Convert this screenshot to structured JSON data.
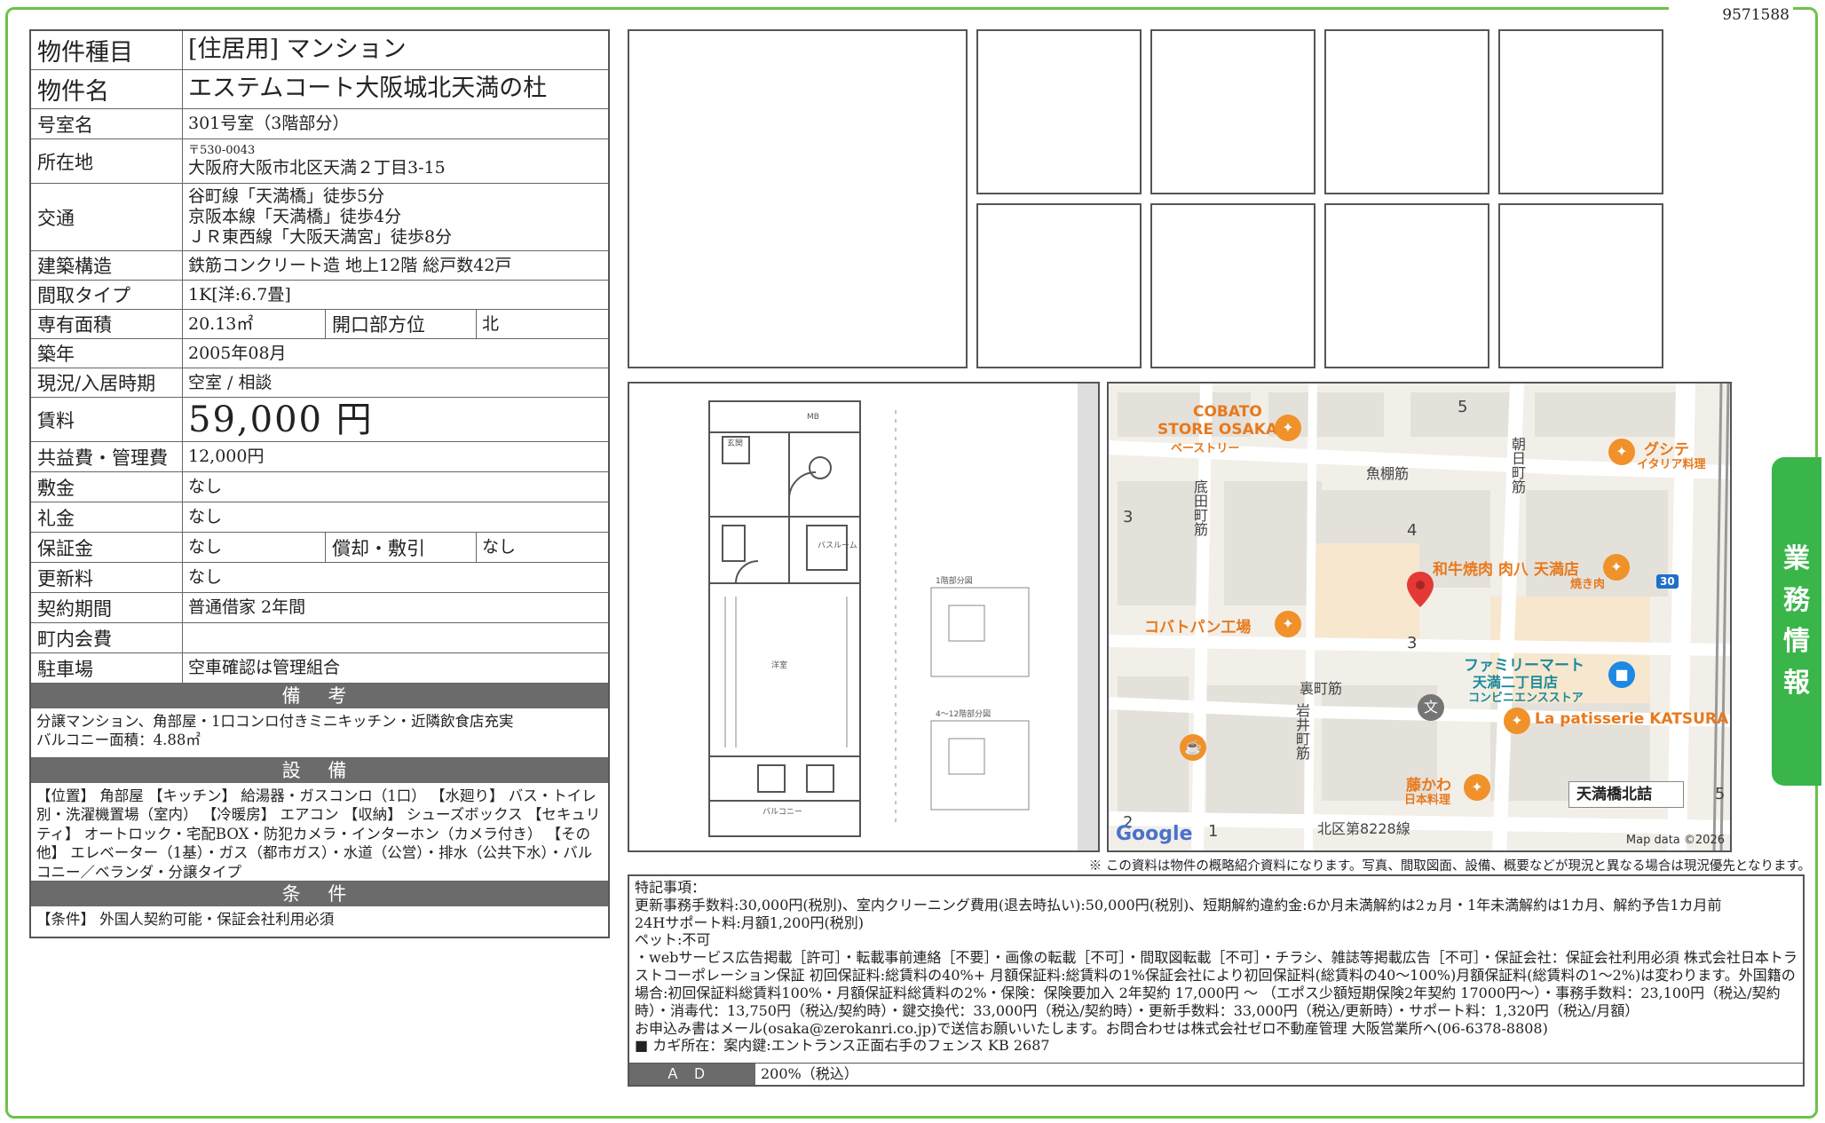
{
  "doc_id": "9571588",
  "property": {
    "type_label": "物件種目",
    "type_value": "[住居用] マンション",
    "name_label": "物件名",
    "name_value": "エステムコート大阪城北天満の杜",
    "room_label": "号室名",
    "room_value": "301号室（3階部分）",
    "address_label": "所在地",
    "postal": "〒530-0043",
    "address": "大阪府大阪市北区天満２丁目3-15",
    "transport_label": "交通",
    "transport": [
      "谷町線「天満橋」徒歩5分",
      "京阪本線「天満橋」徒歩4分",
      "ＪＲ東西線「大阪天満宮」徒歩8分"
    ],
    "structure_label": "建築構造",
    "structure_value": "鉄筋コンクリート造 地上12階 総戸数42戸",
    "layout_label": "間取タイプ",
    "layout_value": "1K[洋:6.7畳]",
    "area_label": "専有面積",
    "area_value": "20.13㎡",
    "direction_label": "開口部方位",
    "direction_value": "北",
    "built_label": "築年",
    "built_value": "2005年08月",
    "status_label": "現況/入居時期",
    "status_value": "空室 / 相談",
    "rent_label": "賃料",
    "rent_value": "59,000 円",
    "fee_label": "共益費・管理費",
    "fee_value": "12,000円",
    "deposit_label": "敷金",
    "deposit_value": "なし",
    "keymoney_label": "礼金",
    "keymoney_value": "なし",
    "guarantee_label": "保証金",
    "guarantee_value": "なし",
    "amort_label": "償却・敷引",
    "amort_value": "なし",
    "renewal_label": "更新料",
    "renewal_value": "なし",
    "contract_label": "契約期間",
    "contract_value": "普通借家 2年間",
    "town_label": "町内会費",
    "town_value": "",
    "parking_label": "駐車場",
    "parking_value": "空車確認は管理組合"
  },
  "remarks": {
    "title": "備 考",
    "lines": [
      "分譲マンション、角部屋・1口コンロ付きミニキッチン・近隣飲食店充実",
      "バルコニー面積：4.88㎡"
    ]
  },
  "equipment": {
    "title": "設 備",
    "text": "【位置】 角部屋 【キッチン】 給湯器・ガスコンロ（1口） 【水廻り】 バス・トイレ別・洗濯機置場（室内） 【冷暖房】 エアコン 【収納】 シューズボックス 【セキュリティ】 オートロック・宅配BOX・防犯カメラ・インターホン（カメラ付き） 【その他】 エレベーター（1基）・ガス（都市ガス）・水道（公営）・排水（公共下水）・バルコニー／ベランダ・分譲タイプ"
  },
  "conditions": {
    "title": "条 件",
    "text": "【条件】 外国人契約可能・保証会社利用必須"
  },
  "map": {
    "labels": {
      "cobato": "COBATO",
      "cobato2": "STORE OSAKA",
      "cobato3": "ベーストリー",
      "gusite": "グシテ",
      "gusite2": "イタリア料理",
      "yakiniku": "和牛焼肉 肉八 天満店",
      "yakiniku2": "焼き肉",
      "kobato": "コバトパン工場",
      "famima": "ファミリーマート",
      "famima2": "天満二丁目店",
      "famima3": "コンビニエンスストア",
      "katsura": "La patisserie KATSURA",
      "fujikawa": "藤かわ",
      "fujikawa2": "日本料理",
      "station": "天満橋北詰",
      "road_uodana": "魚棚筋",
      "road_asahi": "朝日町筋",
      "road_sokoda": "底田町筋",
      "road_uramachi": "裏町筋",
      "road_iwai": "岩井町筋",
      "road_8228": "北区第8228線",
      "n5": "5",
      "n3": "3",
      "n4": "4",
      "n3b": "3",
      "n2": "2",
      "n1": "1",
      "n5b": "5",
      "route30": "30",
      "google": "Google",
      "mapdata": "Map data ©2026"
    }
  },
  "disclaimer": "※ この資料は物件の概略紹介資料になります。写真、間取図面、設備、概要などが現況と異なる場合は現況優先となります。",
  "notes": {
    "lines": [
      "特記事項：",
      "更新事務手数料:30,000円(税別)、室内クリーニング費用(退去時払い):50,000円(税別)、短期解約違約金:6か月未満解約は2ヵ月・1年未満解約は1カ月、解約予告1カ月前",
      "24Hサポート料:月額1,200円(税別)",
      "ペット:不可",
      "・webサービス広告掲載［許可］・転載事前連絡［不要］・画像の転載［不可］・間取図転載［不可］・チラシ、雑誌等掲載広告［不可］・保証会社：保証会社利用必須 株式会社日本トラストコーポレーション保証 初回保証料:総賃料の40%+ 月額保証料:総賃料の1%保証会社により初回保証料(総賃料の40～100%)月額保証料(総賃料の1～2%)は変わります。外国籍の場合:初回保証料総賃料100%・月額保証料総賃料の2%・保険：保険要加入 2年契約 17,000円 ～ （エポス少額短期保険2年契約 17000円～）・事務手数料：23,100円（税込/契約時）・消毒代：13,750円（税込/契約時）・鍵交換代：33,000円（税込/契約時）・更新手数料：33,000円（税込/更新時）・サポート料：1,320円（税込/月額）",
      "お申込み書はメール(osaka@zerokanri.co.jp)で送信お願いいたします。お問合わせは株式会社ゼロ不動産管理 大阪営業所へ(06-6378-8808)",
      "■ カギ所在：案内鍵:エントランス正面右手のフェンス KB 2687"
    ],
    "ad_label": "ＡＤ",
    "ad_value": "200%（税込）"
  },
  "side_tab": [
    "業",
    "務",
    "情",
    "報"
  ],
  "colors": {
    "frame": "#6cc24a",
    "tab": "#3ab54a",
    "section_bar": "#6b6b6b"
  }
}
